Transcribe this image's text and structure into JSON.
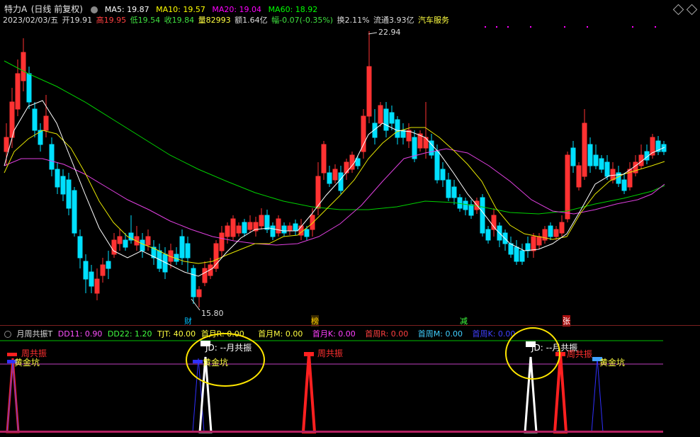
{
  "header": {
    "stock_name": "特力A",
    "period": "(日线 前复权)",
    "ma5": "MA5: 19.87",
    "ma10": "MA10: 19.57",
    "ma20": "MA20: 19.04",
    "ma60": "MA60: 18.92",
    "date": "2023/02/03/五",
    "open": "开19.91",
    "high": "高19.95",
    "low": "低19.54",
    "close": "收19.84",
    "volume": "量82993",
    "amount": "额1.64亿",
    "change": "幅-0.07(-0.35%)",
    "turnover": "换2.11%",
    "float": "流通3.93亿",
    "sector": "汽车服务"
  },
  "main_chart": {
    "high_marker": "22.94",
    "low_marker": "15.80",
    "bottom_tags": [
      "财",
      "榜",
      "减",
      "张"
    ]
  },
  "indicator": {
    "name": "月周共振T",
    "dd11": "DD11: 0.90",
    "dd22": "DD22: 1.20",
    "tjt": "TJT: 40.00",
    "syr": "首月R: 0.00",
    "sym": "首月M: 0.00",
    "syk": "首月K: 0.00",
    "szr": "首周R: 0.00",
    "szm": "首周M: 0.00",
    "szk": "首周K: 0.00",
    "labels": {
      "zgz": "周共振",
      "hjk": "黄金坑",
      "ygz": "JD: --月共振"
    }
  },
  "colors": {
    "up": "#ff3232",
    "down": "#00e0ff",
    "ma5": "#ffffff",
    "ma10": "#ffff00",
    "ma20": "#ff00ff",
    "ma60": "#00ff00",
    "highlight": "#ffe600"
  }
}
